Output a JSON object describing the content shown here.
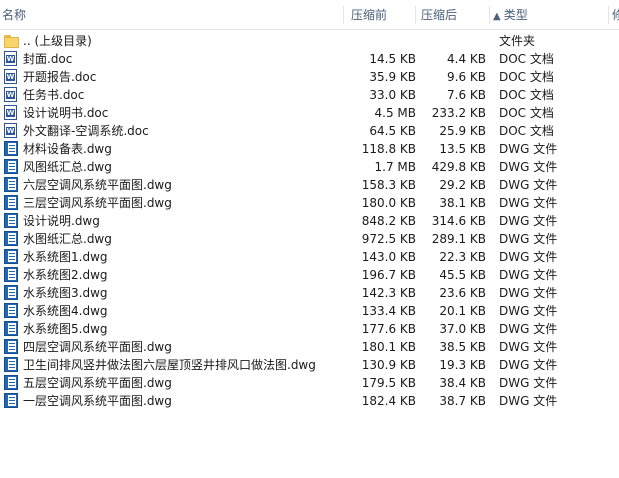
{
  "columns": {
    "name": "名称",
    "size_before": "压缩前",
    "size_after": "压缩后",
    "sort_indicator": "▲",
    "type": "类型",
    "extra": "修"
  },
  "icons": {
    "folder": "folder-icon",
    "doc": "word-doc-icon",
    "dwg": "dwg-file-icon"
  },
  "files": [
    {
      "name": ".. (上级目录)",
      "before": "",
      "after": "",
      "type": "文件夹",
      "icon": "folder"
    },
    {
      "name": "封面.doc",
      "before": "14.5 KB",
      "after": "4.4 KB",
      "type": "DOC 文档",
      "icon": "doc"
    },
    {
      "name": "开题报告.doc",
      "before": "35.9 KB",
      "after": "9.6 KB",
      "type": "DOC 文档",
      "icon": "doc"
    },
    {
      "name": "任务书.doc",
      "before": "33.0 KB",
      "after": "7.6 KB",
      "type": "DOC 文档",
      "icon": "doc"
    },
    {
      "name": "设计说明书.doc",
      "before": "4.5 MB",
      "after": "233.2 KB",
      "type": "DOC 文档",
      "icon": "doc"
    },
    {
      "name": "外文翻译-空调系统.doc",
      "before": "64.5 KB",
      "after": "25.9 KB",
      "type": "DOC 文档",
      "icon": "doc"
    },
    {
      "name": "材料设备表.dwg",
      "before": "118.8 KB",
      "after": "13.5 KB",
      "type": "DWG 文件",
      "icon": "dwg"
    },
    {
      "name": "风图纸汇总.dwg",
      "before": "1.7 MB",
      "after": "429.8 KB",
      "type": "DWG 文件",
      "icon": "dwg"
    },
    {
      "name": "六层空调风系统平面图.dwg",
      "before": "158.3 KB",
      "after": "29.2 KB",
      "type": "DWG 文件",
      "icon": "dwg"
    },
    {
      "name": "三层空调风系统平面图.dwg",
      "before": "180.0 KB",
      "after": "38.1 KB",
      "type": "DWG 文件",
      "icon": "dwg"
    },
    {
      "name": "设计说明.dwg",
      "before": "848.2 KB",
      "after": "314.6 KB",
      "type": "DWG 文件",
      "icon": "dwg"
    },
    {
      "name": "水图纸汇总.dwg",
      "before": "972.5 KB",
      "after": "289.1 KB",
      "type": "DWG 文件",
      "icon": "dwg"
    },
    {
      "name": "水系统图1.dwg",
      "before": "143.0 KB",
      "after": "22.3 KB",
      "type": "DWG 文件",
      "icon": "dwg"
    },
    {
      "name": "水系统图2.dwg",
      "before": "196.7 KB",
      "after": "45.5 KB",
      "type": "DWG 文件",
      "icon": "dwg"
    },
    {
      "name": "水系统图3.dwg",
      "before": "142.3 KB",
      "after": "23.6 KB",
      "type": "DWG 文件",
      "icon": "dwg"
    },
    {
      "name": "水系统图4.dwg",
      "before": "133.4 KB",
      "after": "20.1 KB",
      "type": "DWG 文件",
      "icon": "dwg"
    },
    {
      "name": "水系统图5.dwg",
      "before": "177.6 KB",
      "after": "37.0 KB",
      "type": "DWG 文件",
      "icon": "dwg"
    },
    {
      "name": "四层空调风系统平面图.dwg",
      "before": "180.1 KB",
      "after": "38.5 KB",
      "type": "DWG 文件",
      "icon": "dwg"
    },
    {
      "name": "卫生间排风竖井做法图六层屋顶竖井排风口做法图.dwg",
      "before": "130.9 KB",
      "after": "19.3 KB",
      "type": "DWG 文件",
      "icon": "dwg"
    },
    {
      "name": "五层空调风系统平面图.dwg",
      "before": "179.5 KB",
      "after": "38.4 KB",
      "type": "DWG 文件",
      "icon": "dwg"
    },
    {
      "name": "一层空调风系统平面图.dwg",
      "before": "182.4 KB",
      "after": "38.7 KB",
      "type": "DWG 文件",
      "icon": "dwg"
    }
  ]
}
